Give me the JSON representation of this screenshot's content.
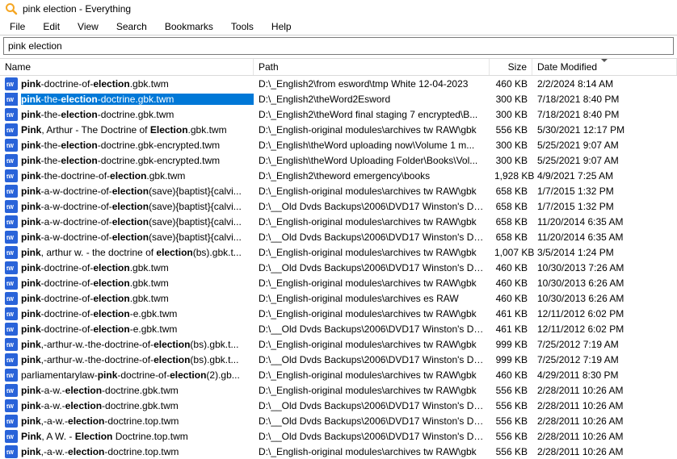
{
  "window": {
    "title": "pink election - Everything"
  },
  "menu": [
    "File",
    "Edit",
    "View",
    "Search",
    "Bookmarks",
    "Tools",
    "Help"
  ],
  "search": {
    "value": "pink election"
  },
  "columns": {
    "name": "Name",
    "path": "Path",
    "size": "Size",
    "date": "Date Modified"
  },
  "match_terms": [
    "pink",
    "election"
  ],
  "rows": [
    {
      "name": "pink-doctrine-of-election.gbk.twm",
      "path": "D:\\_English2\\from esword\\tmp White 12-04-2023",
      "size": "460 KB",
      "date": "2/2/2024 8:14 AM",
      "selected": false
    },
    {
      "name": "pink-the-election-doctrine.gbk.twm",
      "path": "D:\\_English2\\theWord2Esword",
      "size": "300 KB",
      "date": "7/18/2021 8:40 PM",
      "selected": true
    },
    {
      "name": "pink-the-election-doctrine.gbk.twm",
      "path": "D:\\_English2\\theWord final staging 7 encrypted\\B...",
      "size": "300 KB",
      "date": "7/18/2021 8:40 PM",
      "selected": false
    },
    {
      "name": "Pink, Arthur - The Doctrine of Election.gbk.twm",
      "path": "D:\\_English-original modules\\archives tw RAW\\gbk",
      "size": "556 KB",
      "date": "5/30/2021 12:17 PM",
      "selected": false
    },
    {
      "name": "pink-the-election-doctrine.gbk-encrypted.twm",
      "path": "D:\\_English\\theWord uploading now\\Volume 1 m...",
      "size": "300 KB",
      "date": "5/25/2021 9:07 AM",
      "selected": false
    },
    {
      "name": "pink-the-election-doctrine.gbk-encrypted.twm",
      "path": "D:\\_English\\theWord Uploading Folder\\Books\\Vol...",
      "size": "300 KB",
      "date": "5/25/2021 9:07 AM",
      "selected": false
    },
    {
      "name": "pink-the-doctrine-of-election.gbk.twm",
      "path": "D:\\_English2\\theword emergency\\books",
      "size": "1,928 KB",
      "date": "4/9/2021 7:25 AM",
      "selected": false
    },
    {
      "name": "pink-a-w-doctrine-of-election(save){baptist}{calvi...",
      "path": "D:\\_English-original modules\\archives tw RAW\\gbk",
      "size": "658 KB",
      "date": "1/7/2015 1:32 PM",
      "selected": false
    },
    {
      "name": "pink-a-w-doctrine-of-election(save){baptist}{calvi...",
      "path": "D:\\__Old Dvds Backups\\2006\\DVD17 Winston's DV...",
      "size": "658 KB",
      "date": "1/7/2015 1:32 PM",
      "selected": false
    },
    {
      "name": "pink-a-w-doctrine-of-election(save){baptist}{calvi...",
      "path": "D:\\_English-original modules\\archives tw RAW\\gbk",
      "size": "658 KB",
      "date": "11/20/2014 6:35 AM",
      "selected": false
    },
    {
      "name": "pink-a-w-doctrine-of-election(save){baptist}{calvi...",
      "path": "D:\\__Old Dvds Backups\\2006\\DVD17 Winston's DV...",
      "size": "658 KB",
      "date": "11/20/2014 6:35 AM",
      "selected": false
    },
    {
      "name": "pink, arthur w. - the doctrine of election(bs).gbk.t...",
      "path": "D:\\_English-original modules\\archives tw RAW\\gbk",
      "size": "1,007 KB",
      "date": "3/5/2014 1:24 PM",
      "selected": false
    },
    {
      "name": "pink-doctrine-of-election.gbk.twm",
      "path": "D:\\__Old Dvds Backups\\2006\\DVD17 Winston's DV...",
      "size": "460 KB",
      "date": "10/30/2013 7:26 AM",
      "selected": false
    },
    {
      "name": "pink-doctrine-of-election.gbk.twm",
      "path": "D:\\_English-original modules\\archives tw RAW\\gbk",
      "size": "460 KB",
      "date": "10/30/2013 6:26 AM",
      "selected": false
    },
    {
      "name": "pink-doctrine-of-election.gbk.twm",
      "path": "D:\\_English-original modules\\archives es RAW",
      "size": "460 KB",
      "date": "10/30/2013 6:26 AM",
      "selected": false
    },
    {
      "name": "pink-doctrine-of-election-e.gbk.twm",
      "path": "D:\\_English-original modules\\archives tw RAW\\gbk",
      "size": "461 KB",
      "date": "12/11/2012 6:02 PM",
      "selected": false
    },
    {
      "name": "pink-doctrine-of-election-e.gbk.twm",
      "path": "D:\\__Old Dvds Backups\\2006\\DVD17 Winston's DV...",
      "size": "461 KB",
      "date": "12/11/2012 6:02 PM",
      "selected": false
    },
    {
      "name": "pink,-arthur-w.-the-doctrine-of-election(bs).gbk.t...",
      "path": "D:\\_English-original modules\\archives tw RAW\\gbk",
      "size": "999 KB",
      "date": "7/25/2012 7:19 AM",
      "selected": false
    },
    {
      "name": "pink,-arthur-w.-the-doctrine-of-election(bs).gbk.t...",
      "path": "D:\\__Old Dvds Backups\\2006\\DVD17 Winston's DV...",
      "size": "999 KB",
      "date": "7/25/2012 7:19 AM",
      "selected": false
    },
    {
      "name": "parliamentarylaw-pink-doctrine-of-election(2).gb...",
      "path": "D:\\_English-original modules\\archives tw RAW\\gbk",
      "size": "460 KB",
      "date": "4/29/2011 8:30 PM",
      "selected": false
    },
    {
      "name": "pink-a-w.-election-doctrine.gbk.twm",
      "path": "D:\\_English-original modules\\archives tw RAW\\gbk",
      "size": "556 KB",
      "date": "2/28/2011 10:26 AM",
      "selected": false
    },
    {
      "name": "pink-a-w.-election-doctrine.gbk.twm",
      "path": "D:\\__Old Dvds Backups\\2006\\DVD17 Winston's DV...",
      "size": "556 KB",
      "date": "2/28/2011 10:26 AM",
      "selected": false
    },
    {
      "name": "pink,-a-w.-election-doctrine.top.twm",
      "path": "D:\\__Old Dvds Backups\\2006\\DVD17 Winston's DV...",
      "size": "556 KB",
      "date": "2/28/2011 10:26 AM",
      "selected": false
    },
    {
      "name": "Pink, A W. - Election Doctrine.top.twm",
      "path": "D:\\__Old Dvds Backups\\2006\\DVD17 Winston's DV...",
      "size": "556 KB",
      "date": "2/28/2011 10:26 AM",
      "selected": false
    },
    {
      "name": "pink,-a-w.-election-doctrine.top.twm",
      "path": "D:\\_English-original modules\\archives tw RAW\\gbk",
      "size": "556 KB",
      "date": "2/28/2011 10:26 AM",
      "selected": false
    }
  ]
}
